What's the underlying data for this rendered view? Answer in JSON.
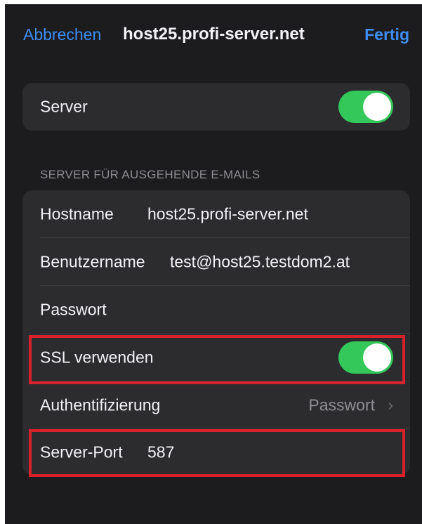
{
  "nav": {
    "cancel_label": "Abbrechen",
    "title": "host25.profi-server.net",
    "done_label": "Fertig"
  },
  "server_toggle": {
    "label": "Server",
    "on": true
  },
  "outgoing_section": {
    "header": "SERVER FÜR AUSGEHENDE E-MAILS",
    "rows": {
      "hostname": {
        "label": "Hostname",
        "value": "host25.profi-server.net"
      },
      "username": {
        "label": "Benutzername",
        "value": "test@host25.testdom2.at"
      },
      "password": {
        "label": "Passwort",
        "value": ""
      },
      "ssl": {
        "label": "SSL verwenden",
        "on": true
      },
      "auth": {
        "label": "Authentifizierung",
        "value": "Passwort"
      },
      "port": {
        "label": "Server-Port",
        "value": "587"
      }
    }
  },
  "colors": {
    "background": "#1c1c1e",
    "card": "#2c2c2e",
    "accent_blue": "#3d8df5",
    "toggle_on": "#34c759",
    "highlight_red": "#d9212b"
  },
  "icons": {
    "chevron": "chevron-right-icon"
  }
}
